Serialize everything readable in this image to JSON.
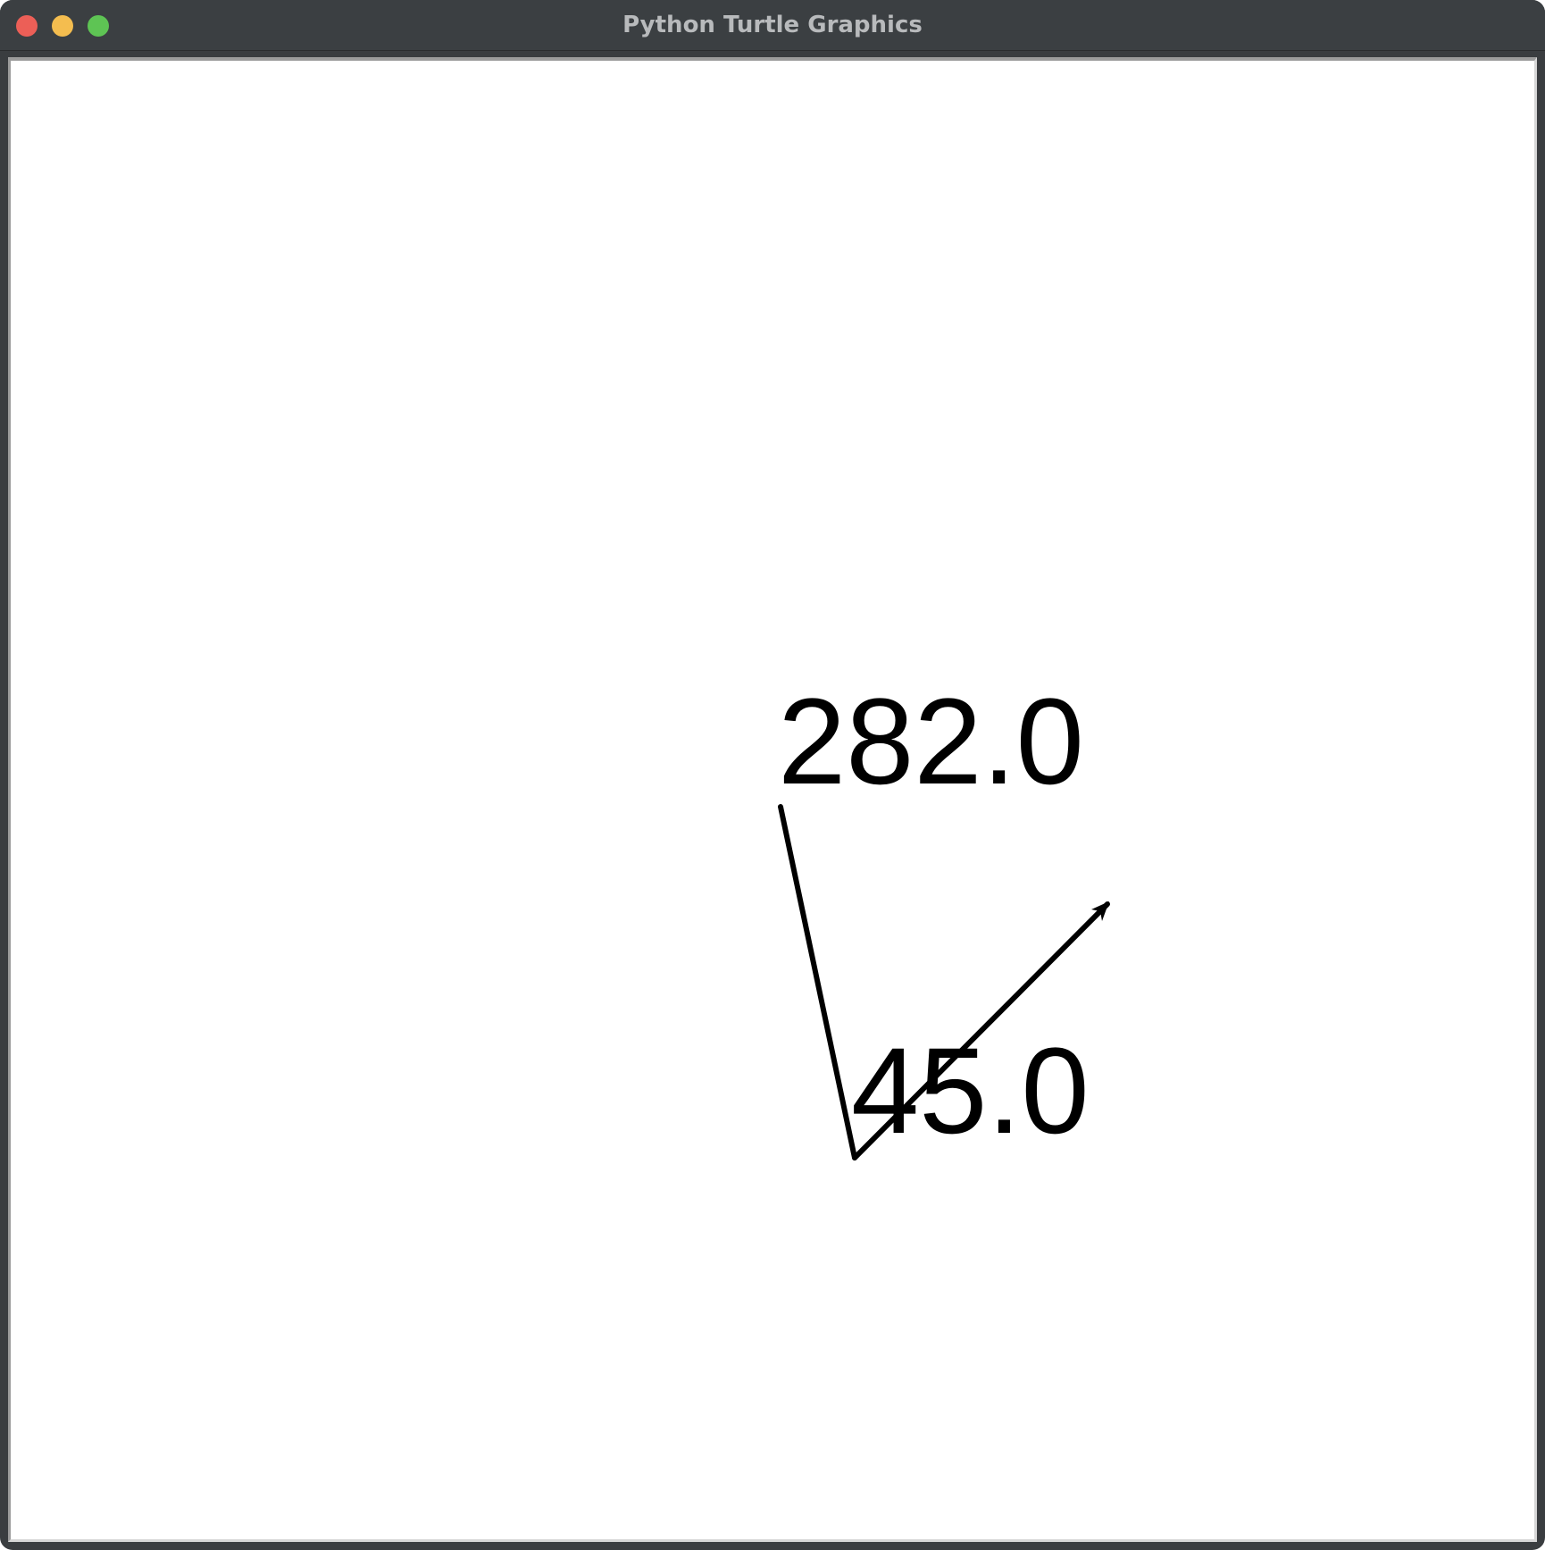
{
  "window": {
    "title": "Python Turtle Graphics"
  },
  "canvas": {
    "background": "#ffffff",
    "pen_color": "#000000",
    "labels": [
      "282.0",
      "45.0"
    ]
  }
}
